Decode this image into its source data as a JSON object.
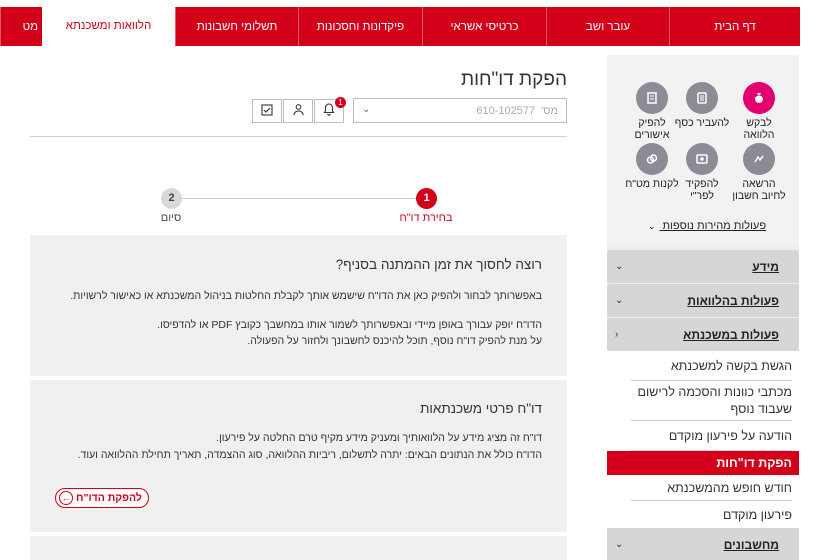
{
  "top_nav": {
    "tabs": [
      {
        "label": "דף הבית"
      },
      {
        "label": "עובר ושב"
      },
      {
        "label": "כרטיסי אשראי"
      },
      {
        "label": "פיקדונות וחסכונות"
      },
      {
        "label": "תשלומי חשבונות"
      },
      {
        "label": "הלוואות ומשכנתא"
      },
      {
        "label": "מט"
      }
    ],
    "active_index": 5
  },
  "sidebar": {
    "quick_actions": [
      {
        "label": "לבקש הלוואה",
        "icon": "money-bag-icon",
        "highlight": true
      },
      {
        "label": "להעביר כסף",
        "icon": "transfer-icon"
      },
      {
        "label": "להפיק אישורים",
        "icon": "document-icon"
      },
      {
        "label": "הרשאה לחיוב חשבון",
        "icon": "authorization-icon"
      },
      {
        "label": "להפקיד לפר\"י",
        "icon": "deposit-icon"
      },
      {
        "label": "לקנות מט\"ח",
        "icon": "currency-icon"
      }
    ],
    "more_actions": "פעולות מהירות נוספות",
    "sections": [
      {
        "label": "מידע"
      },
      {
        "label": "פעולות בהלוואות"
      },
      {
        "label": "פעולות במשכנתא"
      },
      {
        "label": "מחשבונים"
      }
    ],
    "mortgage_items": [
      {
        "label": "הגשת בקשה למשכנתא"
      },
      {
        "label": "מכתבי כוונות והסכמה לרישום שעבוד נוסף"
      },
      {
        "label": "הודעה על פירעון מוקדם"
      },
      {
        "label": "הפקת דו\"חות",
        "active": true
      },
      {
        "label": "חודש חופש מהמשכנתא"
      },
      {
        "label": "פירעון מוקדם"
      }
    ]
  },
  "main": {
    "page_title": "הפקת דו\"חות",
    "account_select": {
      "prefix": "מס'",
      "value": "610-102577"
    },
    "notification_count": "1",
    "steps": [
      {
        "number": "1",
        "label": "בחירת דו\"ח",
        "active": true
      },
      {
        "number": "2",
        "label": "סיום",
        "active": false
      }
    ],
    "info_card": {
      "title": "רוצה לחסוך את זמן ההמתנה בסניף?",
      "line1": "באפשרותך לבחור ולהפיק כאן את הדו\"ח שישמש אותך לקבלת החלטות בניהול המשכנתא או כאישור לרשויות.",
      "line2": "הדו\"ח יופק עבורך באופן מיידי ובאפשרותך לשמור אותו במחשבך כקובץ PDF או להדפיסו.",
      "line3": "על מנת להפיק דו\"ח נוסף, תוכל להיכנס לחשבונך ולחזור על הפעולה."
    },
    "report_card": {
      "title": "דו\"ח פרטי משכנתאות",
      "line1": "דו\"ח זה מציג מידע על הלוואותיך ומעניק מידע מקיף טרם החלטה על פירעון.",
      "line2": "הדו\"ח כולל את הנתונים הבאים: יתרה לתשלום, ריביות ההלוואה, סוג ההצמדה, תאריך תחילת ההלוואה ועוד.",
      "button": "להפקת הדו\"ח"
    }
  },
  "colors": {
    "brand_red": "#d4001a",
    "quick_action_pink": "#e3006f",
    "icon_gray": "#8c8c97"
  }
}
